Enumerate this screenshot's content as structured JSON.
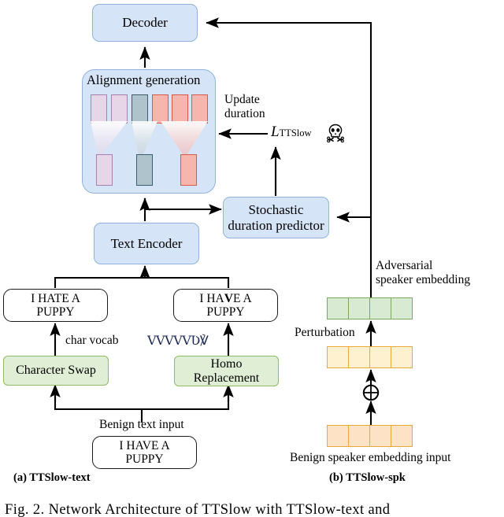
{
  "figure": {
    "caption_a": "(a) TTSlow-text",
    "caption_b": "(b) TTSlow-spk",
    "caption_bottom": "Fig. 2.  Network Architecture of TTSlow with TTSlow-text and"
  },
  "pipeline_text": {
    "decoder": "Decoder",
    "alignment_title": "Alignment generation",
    "text_encoder": "Text Encoder",
    "stochastic_predictor": "Stochastic\nduration predictor",
    "update_duration": "Update\nduration",
    "loss_symbol": "L",
    "loss_subscript": "TTSlow",
    "skull_icon": "skull-icon",
    "skull_glyph": "☠"
  },
  "text_branch": {
    "attacked_left_line1": "I  HATE A",
    "attacked_left_line2": "PUPPY",
    "attacked_right_line1_pre": "I  HA",
    "attacked_right_line1_homo": "V",
    "attacked_right_line1_post": "E A",
    "attacked_right_line2": "PUPPY",
    "char_vocab_label": "char vocab",
    "homoglyph_sequence": "VVVVVƲ℣",
    "character_swap": "Character Swap",
    "homo_replacement_line1": "Homo",
    "homo_replacement_line2": "Replacement",
    "benign_text_label": "Benign text input",
    "benign_text_line1": "I  HAVE A",
    "benign_text_line2": "PUPPY"
  },
  "spk_branch": {
    "adversarial_label_line1": "Adversarial",
    "adversarial_label_line2": "speaker embedding",
    "perturbation_label": "Perturbation",
    "benign_spk_label": "Benign speaker embedding input",
    "plus_operator": "⊕",
    "embedding_cells": 4,
    "rows": [
      {
        "name": "adversarial-speaker-embedding",
        "color": "#d9ead3"
      },
      {
        "name": "perturbation-embedding",
        "color": "#fdf1cf"
      },
      {
        "name": "benign-speaker-embedding",
        "color": "#fde2c6"
      }
    ]
  },
  "alignment_boxes": {
    "top_row": [
      {
        "fill": "#e6d6e8",
        "stroke": "#a97fb0"
      },
      {
        "fill": "#e6d6e8",
        "stroke": "#a97fb0"
      },
      {
        "fill": "#aec3cc",
        "stroke": "#3e5c6b"
      },
      {
        "fill": "#f7b6ad",
        "stroke": "#d9584a"
      },
      {
        "fill": "#f7b6ad",
        "stroke": "#d9584a"
      },
      {
        "fill": "#f7b6ad",
        "stroke": "#d9584a"
      }
    ],
    "bottom_row": [
      {
        "fill": "#e6d6e8",
        "stroke": "#a97fb0"
      },
      {
        "fill": "#aec3cc",
        "stroke": "#3e5c6b"
      },
      {
        "fill": "#f7b6ad",
        "stroke": "#d9584a"
      }
    ]
  },
  "colors": {
    "blue_fill": "#d6e4f7",
    "blue_stroke": "#8fb3dd",
    "green_fill": "#dfeed4",
    "green_stroke": "#8fba68",
    "arrow": "#000000",
    "background": "#ffffff"
  }
}
